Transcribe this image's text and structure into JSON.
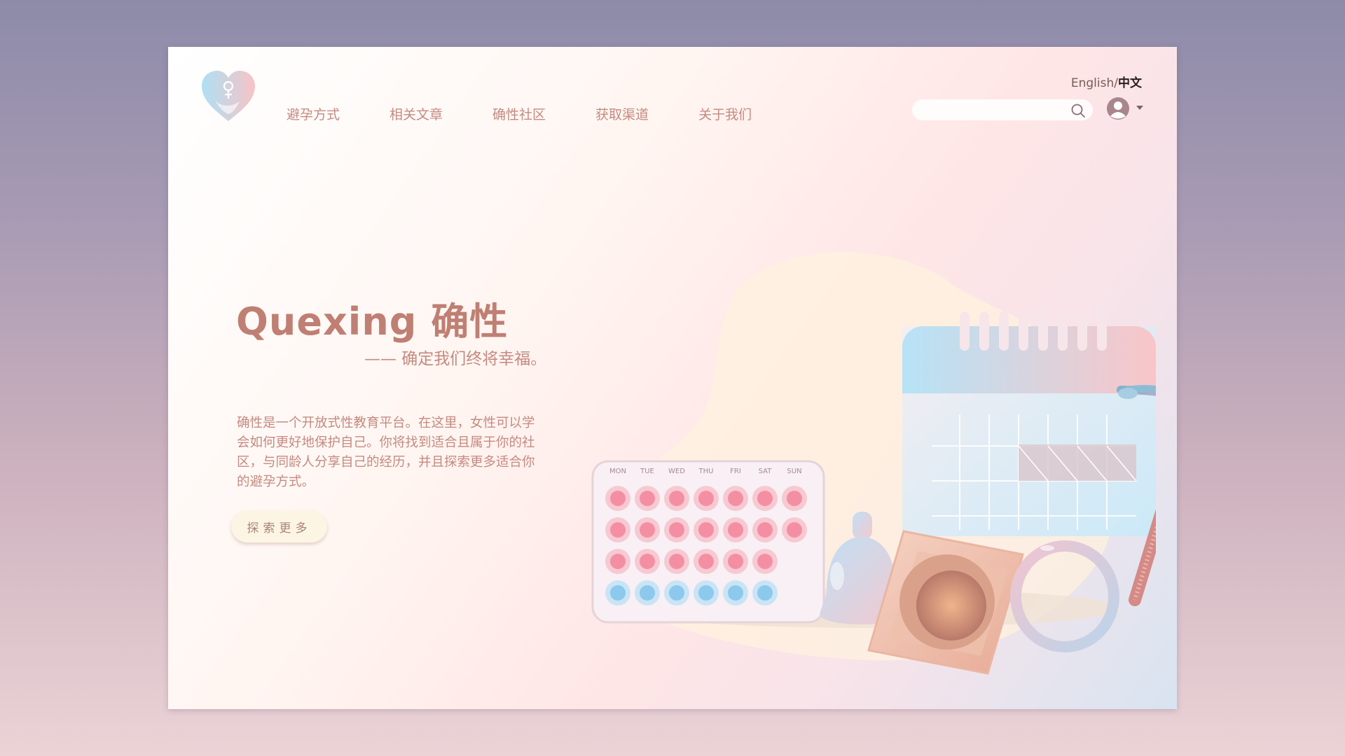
{
  "nav": {
    "items": [
      "避孕方式",
      "相关文章",
      "确性社区",
      "获取渠道",
      "关于我们"
    ]
  },
  "language": {
    "english": "English",
    "separator": "/",
    "chinese": "中文"
  },
  "search": {
    "placeholder": ""
  },
  "hero": {
    "title": "Quexing 确性",
    "subtitle": "—— 确定我们终将幸福。",
    "description": "确性是一个开放式性教育平台。在这里，女性可以学会如何更好地保护自己。你将找到适合且属于你的社区，与同龄人分享自己的经历，并且探索更多适合你的避孕方式。",
    "cta_label": "探索更多"
  },
  "calendar_days": [
    "MON",
    "TUE",
    "WED",
    "THU",
    "FRI",
    "SAT",
    "SUN"
  ],
  "colors": {
    "accent": "#c07f73",
    "button_bg": "#fdf5e3",
    "pill_pink": "#f48fa3",
    "pill_blue": "#8cc9ec"
  },
  "icons": [
    "heart-logo-icon",
    "search-icon",
    "user-avatar-icon",
    "caret-down-icon"
  ]
}
